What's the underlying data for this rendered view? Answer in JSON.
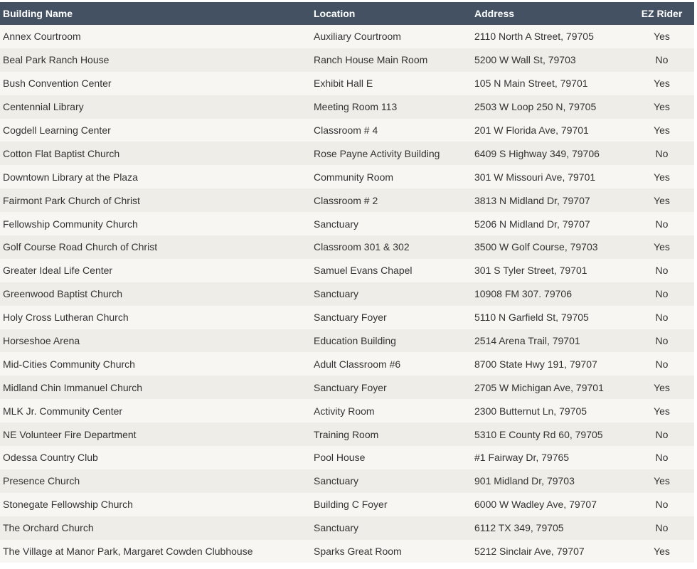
{
  "table": {
    "headers": [
      "Building Name",
      "Location",
      "Address",
      "EZ Rider"
    ],
    "rows": [
      [
        "Annex Courtroom",
        "Auxiliary Courtroom",
        "2110 North A Street, 79705",
        "Yes"
      ],
      [
        "Beal Park Ranch House",
        "Ranch House Main Room",
        "5200 W Wall St, 79703",
        "No"
      ],
      [
        "Bush Convention Center",
        "Exhibit Hall E",
        "105 N Main Street, 79701",
        "Yes"
      ],
      [
        "Centennial Library",
        "Meeting Room 113",
        "2503 W Loop 250 N, 79705",
        "Yes"
      ],
      [
        "Cogdell Learning Center",
        "Classroom # 4",
        "201 W Florida Ave, 79701",
        "Yes"
      ],
      [
        "Cotton Flat Baptist Church",
        "Rose Payne Activity Building",
        "6409 S Highway 349, 79706",
        "No"
      ],
      [
        "Downtown Library at the Plaza",
        "Community Room",
        "301 W Missouri Ave, 79701",
        "Yes"
      ],
      [
        "Fairmont Park Church of Christ",
        "Classroom # 2",
        "3813 N Midland Dr, 79707",
        "Yes"
      ],
      [
        "Fellowship Community Church",
        "Sanctuary",
        "5206 N Midland Dr, 79707",
        "No"
      ],
      [
        "Golf Course Road Church of Christ",
        "Classroom 301 & 302",
        "3500 W Golf Course, 79703",
        "Yes"
      ],
      [
        "Greater Ideal Life Center",
        "Samuel Evans Chapel",
        "301 S Tyler Street, 79701",
        "No"
      ],
      [
        "Greenwood Baptist Church",
        "Sanctuary",
        "10908 FM 307. 79706",
        "No"
      ],
      [
        "Holy Cross Lutheran Church",
        "Sanctuary Foyer",
        "5110 N Garfield St, 79705",
        "No"
      ],
      [
        "Horseshoe Arena",
        "Education Building",
        "2514 Arena Trail, 79701",
        "No"
      ],
      [
        "Mid-Cities Community Church",
        "Adult Classroom #6",
        "8700 State Hwy 191, 79707",
        "No"
      ],
      [
        "Midland Chin Immanuel Church",
        "Sanctuary Foyer",
        "2705 W Michigan Ave, 79701",
        "Yes"
      ],
      [
        "MLK Jr. Community Center",
        "Activity Room",
        "2300 Butternut Ln, 79705",
        "Yes"
      ],
      [
        "NE Volunteer Fire Department",
        "Training Room",
        "5310 E County Rd 60, 79705",
        "No"
      ],
      [
        "Odessa Country Club",
        "Pool House",
        "#1 Fairway Dr, 79765",
        "No"
      ],
      [
        "Presence Church",
        "Sanctuary",
        "901 Midland Dr, 79703",
        "Yes"
      ],
      [
        "Stonegate Fellowship Church",
        "Building C Foyer",
        "6000 W Wadley Ave, 79707",
        "No"
      ],
      [
        "The Orchard Church",
        "Sanctuary",
        "6112 TX 349, 79705",
        "No"
      ],
      [
        "The Village at Manor Park, Margaret Cowden Clubhouse",
        "Sparks Great Room",
        "5212 Sinclair Ave, 79707",
        "Yes"
      ]
    ]
  },
  "colors": {
    "header_bg": "#435163",
    "header_text": "#ffffff",
    "row_odd": "#f7f6f3",
    "row_even": "#efede8",
    "cell_text": "#333333"
  }
}
